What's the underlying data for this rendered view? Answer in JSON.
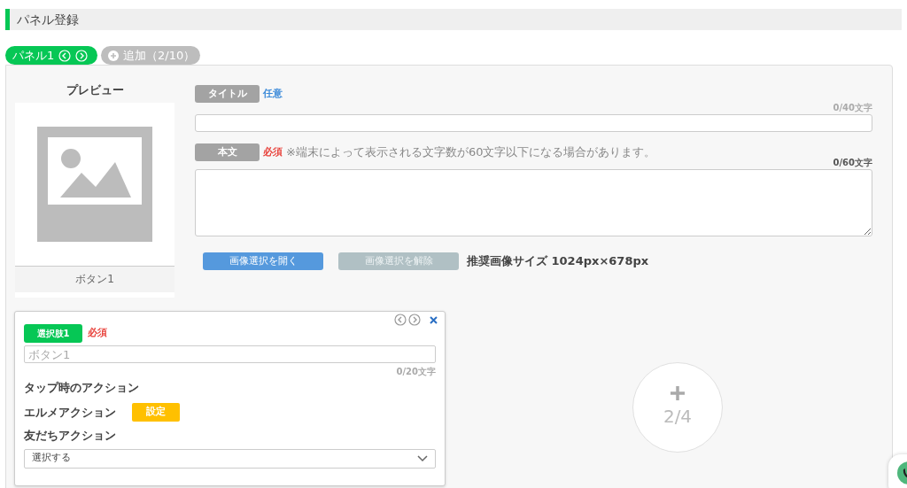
{
  "page_title": "パネル登録",
  "tabs": [
    {
      "label": "パネル1",
      "selected": true,
      "kind": "panel"
    },
    {
      "label": "追加（2/10）",
      "selected": false,
      "kind": "add"
    }
  ],
  "preview": {
    "heading": "プレビュー",
    "button_label": "ボタン1"
  },
  "title_field": {
    "label": "タイトル",
    "tag": "任意",
    "required": false,
    "counter": "0/40文字"
  },
  "body_field": {
    "label": "本文",
    "tag": "必須",
    "required": true,
    "note": "※端末によって表示される文字数が60文字以下になる場合があります。",
    "counter": "0/60文字"
  },
  "image_buttons": [
    {
      "label": "画像選択を開く",
      "disabled": false
    },
    {
      "label": "画像選択を解除",
      "disabled": true
    }
  ],
  "image_size_note": "推奨画像サイズ 1024px×678px",
  "choice": {
    "label": "選択肢1",
    "tag": "必須",
    "required": true,
    "placeholder": "ボタン1",
    "counter": "0/20文字",
    "tap_action": "タップ時のアクション",
    "elme_action": "エルメアクション",
    "set_button": "設定",
    "friend_action": "友だちアクション",
    "select_value": "選択する"
  },
  "add_choice": {
    "count": "2/4"
  }
}
